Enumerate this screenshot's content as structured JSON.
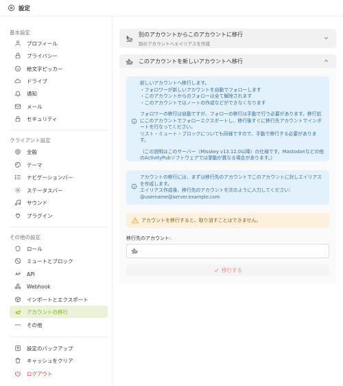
{
  "header": {
    "title": "設定"
  },
  "sidebar": {
    "sections": [
      {
        "title": "基本設定",
        "items": [
          {
            "label": "プロフィール",
            "icon": "user-icon"
          },
          {
            "label": "プライバシー",
            "icon": "lock-icon"
          },
          {
            "label": "絵文字ピッカー",
            "icon": "mood-icon"
          },
          {
            "label": "ドライブ",
            "icon": "cloud-icon"
          },
          {
            "label": "通知",
            "icon": "bell-icon"
          },
          {
            "label": "メール",
            "icon": "mail-icon"
          },
          {
            "label": "セキュリティ",
            "icon": "lock-icon"
          }
        ]
      },
      {
        "title": "クライアント設定",
        "items": [
          {
            "label": "全般",
            "icon": "settings-icon"
          },
          {
            "label": "テーマ",
            "icon": "palette-icon"
          },
          {
            "label": "ナビゲーションバー",
            "icon": "list-icon"
          },
          {
            "label": "ステータスバー",
            "icon": "status-icon"
          },
          {
            "label": "サウンド",
            "icon": "music-icon"
          },
          {
            "label": "プラグイン",
            "icon": "plug-icon"
          }
        ]
      },
      {
        "title": "その他の設定",
        "items": [
          {
            "label": "ロール",
            "icon": "badge-icon"
          },
          {
            "label": "ミュートとブロック",
            "icon": "ban-icon"
          },
          {
            "label": "API",
            "icon": "api-icon"
          },
          {
            "label": "Webhook",
            "icon": "webhook-icon"
          },
          {
            "label": "インポートとエクスポート",
            "icon": "package-icon"
          },
          {
            "label": "アカウントの移行",
            "icon": "plane-icon",
            "active": true
          },
          {
            "label": "その他",
            "icon": "dots-icon"
          }
        ]
      }
    ],
    "footer_items": [
      {
        "label": "設定のバックアップ",
        "icon": "backup-icon"
      },
      {
        "label": "キャッシュをクリア",
        "icon": "trash-icon"
      },
      {
        "label": "ログアウト",
        "icon": "power-icon",
        "danger": true
      }
    ]
  },
  "main": {
    "folder_alias": {
      "title": "別のアカウントからこのアカウントに移行",
      "subtitle": "別のアカウントへエイリアスを作成"
    },
    "folder_migrate": {
      "title": "このアカウントを新しいアカウントへ移行"
    },
    "info1": {
      "para1": "新しいアカウントへ移行します。\n・フォロワーが新しいアカウントを自動でフォローします\n・このアカウントからのフォローは全て解除されます\n・このアカウントではノートの作成などができなくなります",
      "para2": "フォロワーの移行は自動ですが、フォローの移行は手動で行う必要があります。移行前にこのアカウントでフォローエクスポートし、移行後すぐに移行先アカウントでインポートを行なってください。\nリスト・ミュート・ブロックについても同様ですので、手動で移行する必要があります。",
      "para3": "（この説明はこのサーバー（Misskey v13.12.0以降）の仕様です。Mastodonなどの他のActivityPubソフトウェアでは挙動が異なる場合があります。）"
    },
    "info2": {
      "text": "アカウントの移行には、まずは移行先のアカウントでこのアカウントに対しエイリアスを作成します。\nエイリアス作成後、移行先のアカウントを次のように入力してください: @username@server.example.com"
    },
    "warning": "アカウントを移行すると、取り消すことはできません。",
    "target_label": "移行先のアカウント:",
    "target_value": "",
    "submit_label": "移行する",
    "colors": {
      "accent": "#86b300",
      "danger": "#e0413a",
      "info_bg": "#e3f1fc",
      "warn_bg": "#fdf1de"
    }
  }
}
